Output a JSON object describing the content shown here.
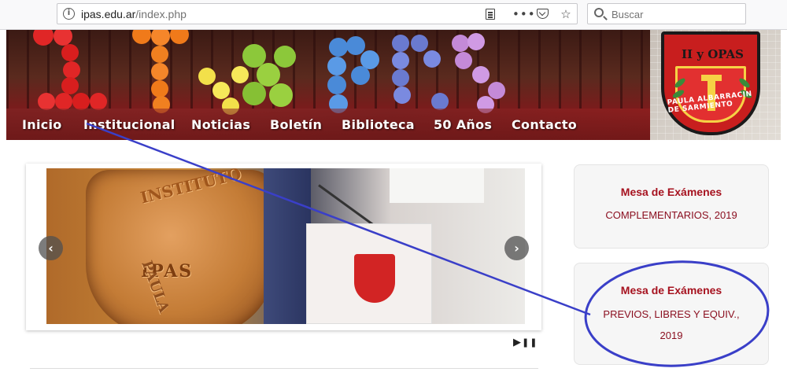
{
  "browser": {
    "url_host": "ipas.edu.ar",
    "url_path": "/index.php",
    "search_placeholder": "Buscar",
    "more_glyph": "•••",
    "star_glyph": "☆",
    "info_glyph": "i"
  },
  "header": {
    "nav_items": [
      "Inicio",
      "Institucional",
      "Noticias",
      "Boletín",
      "Biblioteca",
      "50 Años",
      "Contacto"
    ],
    "logo_title": "II y OPAS",
    "logo_ring_text": "PAULA ALBARRACIN DE SARMIENTO"
  },
  "slider": {
    "plaque_top": "INSTITUTO",
    "plaque_center": "IPAS",
    "plaque_side": "PAULA",
    "prev_glyph": "‹",
    "next_glyph": "›",
    "play_glyph": "▶",
    "pause_glyph": "❚❚"
  },
  "sidebar": {
    "cards": [
      {
        "title": "Mesa de Exámenes",
        "lines": [
          "COMPLEMENTARIOS, 2019"
        ]
      },
      {
        "title": "Mesa de Exámenes",
        "lines": [
          "PREVIOS, LIBRES Y EQUIV.,",
          "2019"
        ]
      }
    ]
  },
  "colors": {
    "accent_red": "#a6121f",
    "annotation_blue": "#3a3fc8",
    "banner_maroon": "#7a1c1c"
  }
}
